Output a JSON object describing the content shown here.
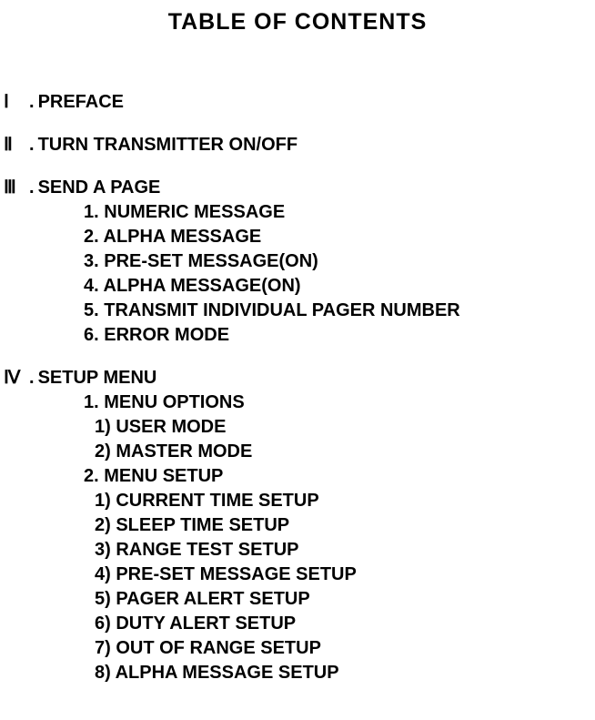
{
  "title": "TABLE OF CONTENTS",
  "sections": [
    {
      "roman": "Ⅰ",
      "sep": ".",
      "label": "PREFACE",
      "items": []
    },
    {
      "roman": "Ⅱ",
      "sep": ".",
      "label": "TURN TRANSMITTER ON/OFF",
      "items": []
    },
    {
      "roman": "Ⅲ",
      "sep": ".",
      "label": "SEND A PAGE",
      "items": [
        {
          "num": "1.",
          "label": "NUMERIC MESSAGE",
          "subitems": []
        },
        {
          "num": "2.",
          "label": "ALPHA MESSAGE",
          "subitems": []
        },
        {
          "num": "3.",
          "label": "PRE-SET MESSAGE(ON)",
          "subitems": []
        },
        {
          "num": "4.",
          "label": "ALPHA MESSAGE(ON)",
          "subitems": []
        },
        {
          "num": "5.",
          "label": "TRANSMIT INDIVIDUAL PAGER NUMBER",
          "subitems": []
        },
        {
          "num": "6.",
          "label": "ERROR MODE",
          "subitems": []
        }
      ]
    },
    {
      "roman": "Ⅳ",
      "sep": ".",
      "label": "SETUP MENU",
      "items": [
        {
          "num": "1.",
          "label": "MENU OPTIONS",
          "subitems": [
            {
              "num": "1)",
              "label": "USER MODE"
            },
            {
              "num": "2)",
              "label": "MASTER MODE"
            }
          ]
        },
        {
          "num": "2.",
          "label": "MENU SETUP",
          "subitems": [
            {
              "num": "1)",
              "label": "CURRENT TIME SETUP"
            },
            {
              "num": "2)",
              "label": "SLEEP TIME SETUP"
            },
            {
              "num": "3)",
              "label": "RANGE TEST SETUP"
            },
            {
              "num": "4)",
              "label": "PRE-SET MESSAGE SETUP"
            },
            {
              "num": "5)",
              "label": "PAGER ALERT SETUP"
            },
            {
              "num": "6)",
              "label": "DUTY ALERT SETUP"
            },
            {
              "num": "7)",
              "label": "OUT OF RANGE SETUP"
            },
            {
              "num": "8)",
              "label": "ALPHA MESSAGE SETUP"
            }
          ]
        }
      ]
    }
  ]
}
